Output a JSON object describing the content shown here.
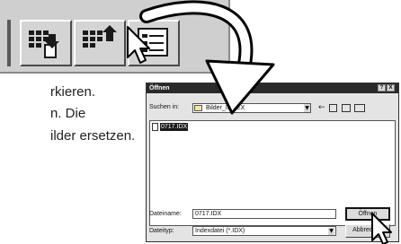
{
  "instructions": {
    "line1_fragment": "rkieren.",
    "line2_fragment": "n. Die",
    "line3_fragment": "ilder ersetzen."
  },
  "toolbar": {
    "buttons": [
      "icon-view-button",
      "open-index-button",
      "list-button"
    ]
  },
  "dialog": {
    "title": "Öffnen",
    "help_button": "?",
    "close_button": "X",
    "look_in_label": "Suchen in:",
    "look_in_value": "Bilder_INDEX",
    "files": [
      "0717.IDX"
    ],
    "filename_label": "Dateiname:",
    "filename_value": "0717.IDX",
    "filetype_label": "Dateityp:",
    "filetype_value": "Indexdatei (*.IDX)",
    "open_button": "Öffnen",
    "cancel_button": "Abbrechen"
  }
}
